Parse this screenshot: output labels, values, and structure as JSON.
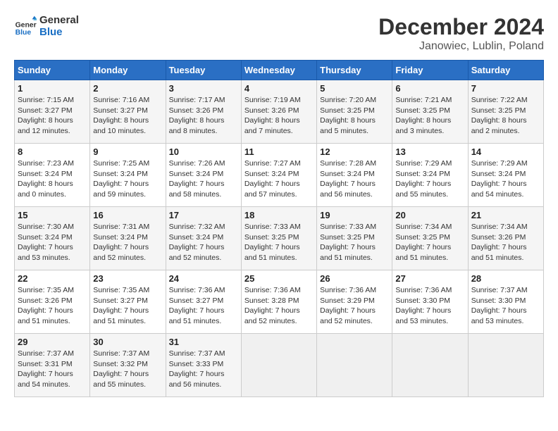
{
  "header": {
    "logo_line1": "General",
    "logo_line2": "Blue",
    "title": "December 2024",
    "subtitle": "Janowiec, Lublin, Poland"
  },
  "calendar": {
    "days_of_week": [
      "Sunday",
      "Monday",
      "Tuesday",
      "Wednesday",
      "Thursday",
      "Friday",
      "Saturday"
    ],
    "weeks": [
      [
        {
          "day": "1",
          "info": "Sunrise: 7:15 AM\nSunset: 3:27 PM\nDaylight: 8 hours and 12 minutes."
        },
        {
          "day": "2",
          "info": "Sunrise: 7:16 AM\nSunset: 3:27 PM\nDaylight: 8 hours and 10 minutes."
        },
        {
          "day": "3",
          "info": "Sunrise: 7:17 AM\nSunset: 3:26 PM\nDaylight: 8 hours and 8 minutes."
        },
        {
          "day": "4",
          "info": "Sunrise: 7:19 AM\nSunset: 3:26 PM\nDaylight: 8 hours and 7 minutes."
        },
        {
          "day": "5",
          "info": "Sunrise: 7:20 AM\nSunset: 3:25 PM\nDaylight: 8 hours and 5 minutes."
        },
        {
          "day": "6",
          "info": "Sunrise: 7:21 AM\nSunset: 3:25 PM\nDaylight: 8 hours and 3 minutes."
        },
        {
          "day": "7",
          "info": "Sunrise: 7:22 AM\nSunset: 3:25 PM\nDaylight: 8 hours and 2 minutes."
        }
      ],
      [
        {
          "day": "8",
          "info": "Sunrise: 7:23 AM\nSunset: 3:24 PM\nDaylight: 8 hours and 0 minutes."
        },
        {
          "day": "9",
          "info": "Sunrise: 7:25 AM\nSunset: 3:24 PM\nDaylight: 7 hours and 59 minutes."
        },
        {
          "day": "10",
          "info": "Sunrise: 7:26 AM\nSunset: 3:24 PM\nDaylight: 7 hours and 58 minutes."
        },
        {
          "day": "11",
          "info": "Sunrise: 7:27 AM\nSunset: 3:24 PM\nDaylight: 7 hours and 57 minutes."
        },
        {
          "day": "12",
          "info": "Sunrise: 7:28 AM\nSunset: 3:24 PM\nDaylight: 7 hours and 56 minutes."
        },
        {
          "day": "13",
          "info": "Sunrise: 7:29 AM\nSunset: 3:24 PM\nDaylight: 7 hours and 55 minutes."
        },
        {
          "day": "14",
          "info": "Sunrise: 7:29 AM\nSunset: 3:24 PM\nDaylight: 7 hours and 54 minutes."
        }
      ],
      [
        {
          "day": "15",
          "info": "Sunrise: 7:30 AM\nSunset: 3:24 PM\nDaylight: 7 hours and 53 minutes."
        },
        {
          "day": "16",
          "info": "Sunrise: 7:31 AM\nSunset: 3:24 PM\nDaylight: 7 hours and 52 minutes."
        },
        {
          "day": "17",
          "info": "Sunrise: 7:32 AM\nSunset: 3:24 PM\nDaylight: 7 hours and 52 minutes."
        },
        {
          "day": "18",
          "info": "Sunrise: 7:33 AM\nSunset: 3:25 PM\nDaylight: 7 hours and 51 minutes."
        },
        {
          "day": "19",
          "info": "Sunrise: 7:33 AM\nSunset: 3:25 PM\nDaylight: 7 hours and 51 minutes."
        },
        {
          "day": "20",
          "info": "Sunrise: 7:34 AM\nSunset: 3:25 PM\nDaylight: 7 hours and 51 minutes."
        },
        {
          "day": "21",
          "info": "Sunrise: 7:34 AM\nSunset: 3:26 PM\nDaylight: 7 hours and 51 minutes."
        }
      ],
      [
        {
          "day": "22",
          "info": "Sunrise: 7:35 AM\nSunset: 3:26 PM\nDaylight: 7 hours and 51 minutes."
        },
        {
          "day": "23",
          "info": "Sunrise: 7:35 AM\nSunset: 3:27 PM\nDaylight: 7 hours and 51 minutes."
        },
        {
          "day": "24",
          "info": "Sunrise: 7:36 AM\nSunset: 3:27 PM\nDaylight: 7 hours and 51 minutes."
        },
        {
          "day": "25",
          "info": "Sunrise: 7:36 AM\nSunset: 3:28 PM\nDaylight: 7 hours and 52 minutes."
        },
        {
          "day": "26",
          "info": "Sunrise: 7:36 AM\nSunset: 3:29 PM\nDaylight: 7 hours and 52 minutes."
        },
        {
          "day": "27",
          "info": "Sunrise: 7:36 AM\nSunset: 3:30 PM\nDaylight: 7 hours and 53 minutes."
        },
        {
          "day": "28",
          "info": "Sunrise: 7:37 AM\nSunset: 3:30 PM\nDaylight: 7 hours and 53 minutes."
        }
      ],
      [
        {
          "day": "29",
          "info": "Sunrise: 7:37 AM\nSunset: 3:31 PM\nDaylight: 7 hours and 54 minutes."
        },
        {
          "day": "30",
          "info": "Sunrise: 7:37 AM\nSunset: 3:32 PM\nDaylight: 7 hours and 55 minutes."
        },
        {
          "day": "31",
          "info": "Sunrise: 7:37 AM\nSunset: 3:33 PM\nDaylight: 7 hours and 56 minutes."
        },
        {
          "day": "",
          "info": ""
        },
        {
          "day": "",
          "info": ""
        },
        {
          "day": "",
          "info": ""
        },
        {
          "day": "",
          "info": ""
        }
      ]
    ]
  }
}
